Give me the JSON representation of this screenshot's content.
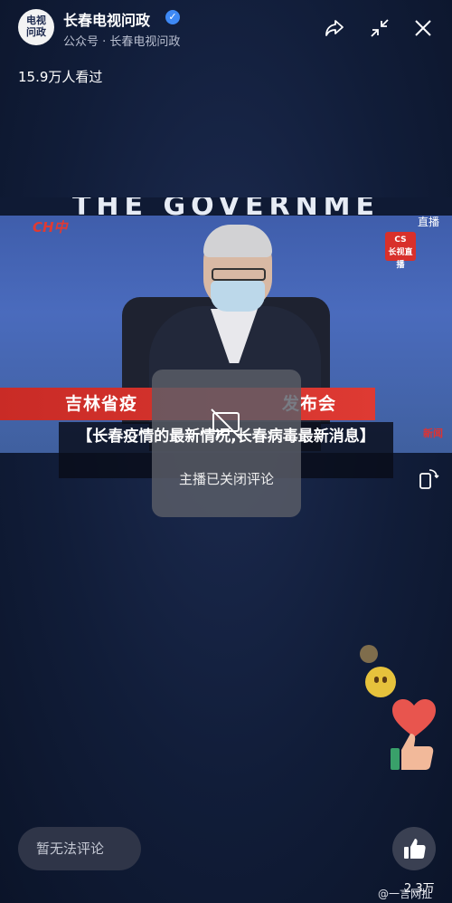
{
  "header": {
    "avatar_text": "电视\n问政",
    "account_name": "长春电视问政",
    "account_sub": "公众号 · 长春电视问政",
    "icons": [
      "share-icon",
      "collapse-icon",
      "close-icon"
    ]
  },
  "views": "15.9万人看过",
  "video": {
    "bg_text": "THE GOVERNME",
    "channel_logo": "CH中",
    "live_label": "直播",
    "cs_logo": "CS\n长视直播",
    "banner_left": "吉林省疫",
    "banner_right": "发布会",
    "watermark": "新闻"
  },
  "title": "【长春疫情的最新情况,长春病毒最新消息】",
  "comments_popup": {
    "text": "主播已关闭评论"
  },
  "comment_input": {
    "placeholder": "暂无法评论"
  },
  "like": {
    "count": "2.3万"
  },
  "watermark": "@一言网扯",
  "colors": {
    "background": "#0f1a34",
    "banner_red": "#d8302b",
    "verified_blue": "#3e89f5"
  }
}
